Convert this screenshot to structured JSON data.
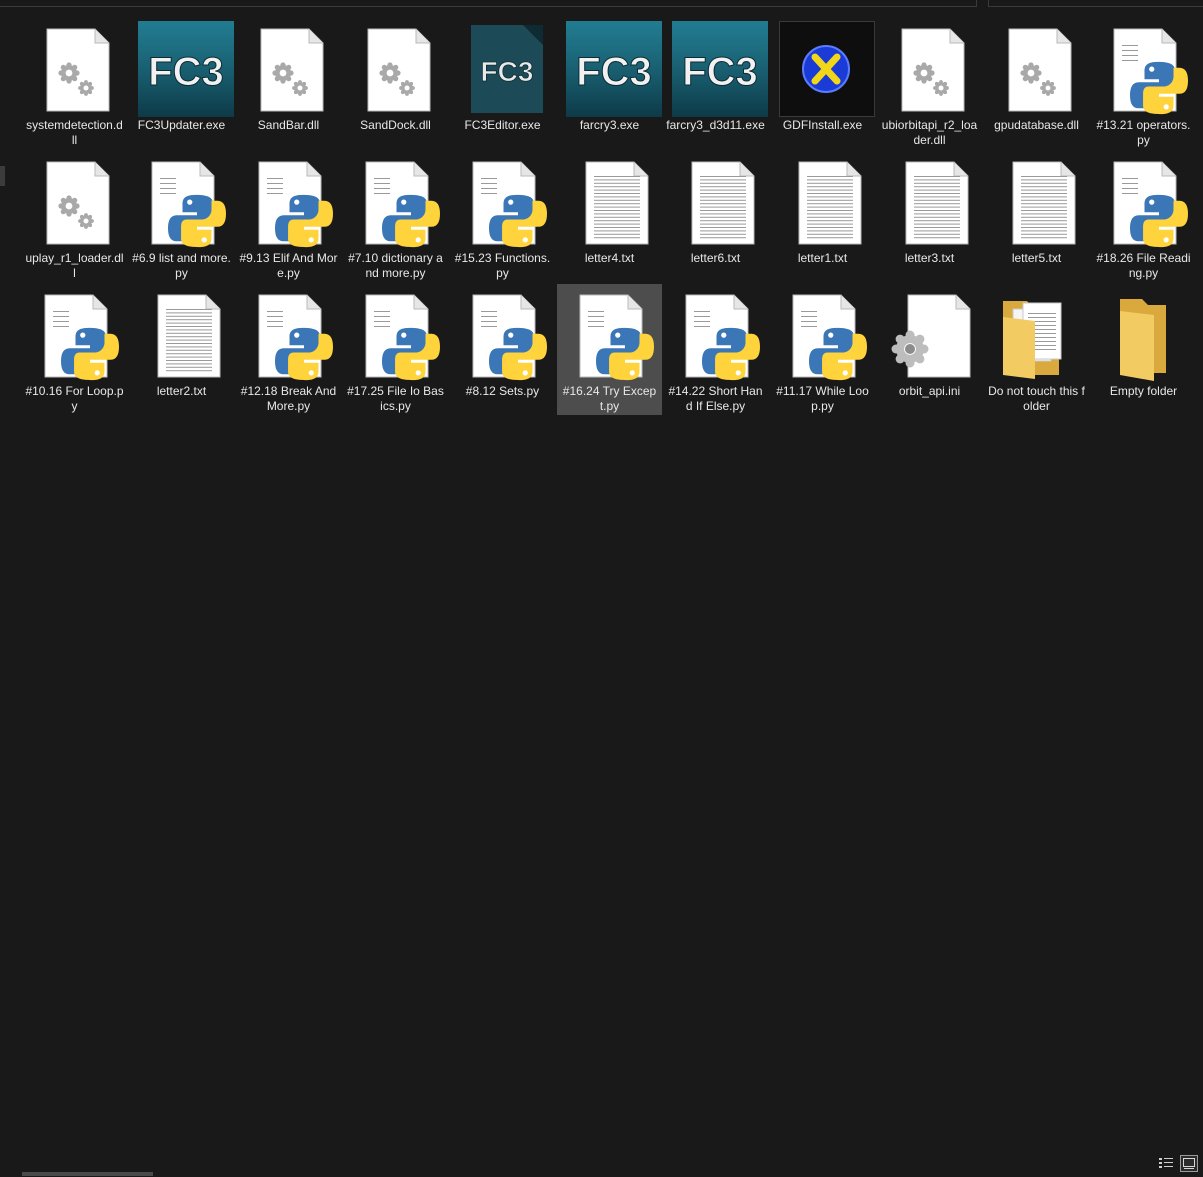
{
  "files": [
    {
      "name": "systemdetection.dll",
      "icon": "gear-file-icon"
    },
    {
      "name": "FC3Updater.exe",
      "icon": "fc3-app-icon",
      "logo": "FC3"
    },
    {
      "name": "SandBar.dll",
      "icon": "gear-file-icon"
    },
    {
      "name": "SandDock.dll",
      "icon": "gear-file-icon"
    },
    {
      "name": "FC3Editor.exe",
      "icon": "fc3-small-app-icon",
      "logo": "FC3"
    },
    {
      "name": "farcry3.exe",
      "icon": "fc3-app-icon",
      "logo": "FC3"
    },
    {
      "name": "farcry3_d3d11.exe",
      "icon": "fc3-app-icon",
      "logo": "FC3"
    },
    {
      "name": "GDFInstall.exe",
      "icon": "gdf-install-icon"
    },
    {
      "name": "ubiorbitapi_r2_loader.dll",
      "icon": "gear-file-icon"
    },
    {
      "name": "gpudatabase.dll",
      "icon": "gear-file-icon"
    },
    {
      "name": "#13.21 operators.py",
      "icon": "python-file-icon"
    },
    {
      "name": "uplay_r1_loader.dll",
      "icon": "gear-file-icon"
    },
    {
      "name": "#6.9 list and more.py",
      "icon": "python-file-icon"
    },
    {
      "name": "#9.13 Elif And More.py",
      "icon": "python-file-icon"
    },
    {
      "name": "#7.10 dictionary and more.py",
      "icon": "python-file-icon"
    },
    {
      "name": "#15.23 Functions.py",
      "icon": "python-file-icon"
    },
    {
      "name": "letter4.txt",
      "icon": "text-file-icon"
    },
    {
      "name": "letter6.txt",
      "icon": "text-file-icon"
    },
    {
      "name": "letter1.txt",
      "icon": "text-file-icon"
    },
    {
      "name": "letter3.txt",
      "icon": "text-file-icon"
    },
    {
      "name": "letter5.txt",
      "icon": "text-file-icon"
    },
    {
      "name": "#18.26 File Reading.py",
      "icon": "python-file-icon"
    },
    {
      "name": "#10.16 For Loop.py",
      "icon": "python-file-icon"
    },
    {
      "name": "letter2.txt",
      "icon": "text-file-icon"
    },
    {
      "name": "#12.18 Break And More.py",
      "icon": "python-file-icon"
    },
    {
      "name": "#17.25 File Io Basics.py",
      "icon": "python-file-icon"
    },
    {
      "name": "#8.12 Sets.py",
      "icon": "python-file-icon"
    },
    {
      "name": "#16.24 Try Except.py",
      "icon": "python-file-icon",
      "selected": true
    },
    {
      "name": "#14.22 Short Hand If Else.py",
      "icon": "python-file-icon"
    },
    {
      "name": "#11.17 While Loop.py",
      "icon": "python-file-icon"
    },
    {
      "name": "orbit_api.ini",
      "icon": "settings-file-icon"
    },
    {
      "name": "Do not touch this folder",
      "icon": "folder-with-files-icon"
    },
    {
      "name": "Empty folder",
      "icon": "empty-folder-icon"
    }
  ],
  "view_buttons": [
    {
      "name": "details-view-button",
      "icon": "details-view-icon",
      "active": false
    },
    {
      "name": "large-icons-view-button",
      "icon": "large-icons-view-icon",
      "active": true
    }
  ],
  "colors": {
    "background": "#191919",
    "selection": "#4d4d4d",
    "text": "#e8e8e8",
    "python_blue": "#3b77b6",
    "python_yellow": "#fed33b",
    "folder_yellow": "#f3cb63",
    "fc3_teal": "#15677a"
  }
}
